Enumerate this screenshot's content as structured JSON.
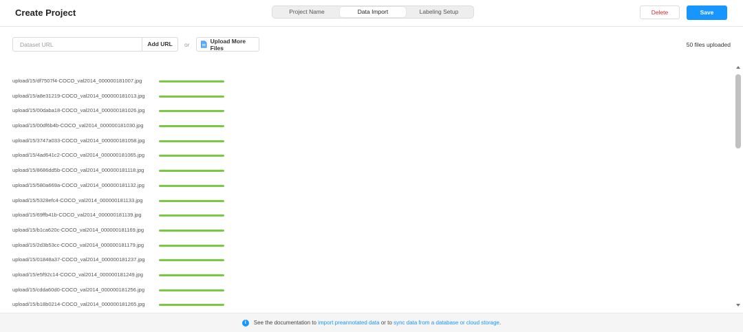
{
  "header": {
    "title": "Create Project",
    "tabs": [
      {
        "label": "Project Name"
      },
      {
        "label": "Data Import"
      },
      {
        "label": "Labeling Setup"
      }
    ],
    "active_tab": "Data Import",
    "delete_label": "Delete",
    "save_label": "Save"
  },
  "import": {
    "url_placeholder": "Dataset URL",
    "add_url_label": "Add URL",
    "or_text": "or",
    "upload_label": "Upload More Files",
    "files_uploaded": "50 files uploaded"
  },
  "files": [
    {
      "name": "upload/15/df7507f4-COCO_val2014_000000181007.jpg",
      "progress": 1.0
    },
    {
      "name": "upload/15/a8e31219-COCO_val2014_000000181013.jpg",
      "progress": 1.0
    },
    {
      "name": "upload/15/00daba18-COCO_val2014_000000181026.jpg",
      "progress": 1.0
    },
    {
      "name": "upload/15/00df6b4b-COCO_val2014_000000181030.jpg",
      "progress": 1.0
    },
    {
      "name": "upload/15/3747a033-COCO_val2014_000000181058.jpg",
      "progress": 1.0
    },
    {
      "name": "upload/15/4ad641c2-COCO_val2014_000000181065.jpg",
      "progress": 1.0
    },
    {
      "name": "upload/15/8686dd5b-COCO_val2014_000000181118.jpg",
      "progress": 1.0
    },
    {
      "name": "upload/15/580a669a-COCO_val2014_000000181132.jpg",
      "progress": 1.0
    },
    {
      "name": "upload/15/5328efc4-COCO_val2014_000000181133.jpg",
      "progress": 1.0
    },
    {
      "name": "upload/15/69ffb41b-COCO_val2014_000000181139.jpg",
      "progress": 1.0
    },
    {
      "name": "upload/15/b1ca620c-COCO_val2014_000000181169.jpg",
      "progress": 1.0
    },
    {
      "name": "upload/15/2d3b53cc-COCO_val2014_000000181179.jpg",
      "progress": 1.0
    },
    {
      "name": "upload/15/01848a37-COCO_val2014_000000181237.jpg",
      "progress": 1.0
    },
    {
      "name": "upload/15/e5f92c14-COCO_val2014_000000181249.jpg",
      "progress": 1.0
    },
    {
      "name": "upload/15/cdda60d0-COCO_val2014_000000181256.jpg",
      "progress": 1.0
    },
    {
      "name": "upload/15/b18b0214-COCO_val2014_000000181265.jpg",
      "progress": 1.0
    }
  ],
  "footer": {
    "text_before": "See the documentation to",
    "link1": "import preannotated data",
    "text_middle": "or to",
    "link2": "sync data from a database or cloud storage",
    "text_after": "."
  },
  "colors": {
    "accent": "#1896ff",
    "progress": "#7ac943",
    "danger": "#d92b2b"
  },
  "icons": {
    "info": "info-icon",
    "file": "file-icon"
  }
}
